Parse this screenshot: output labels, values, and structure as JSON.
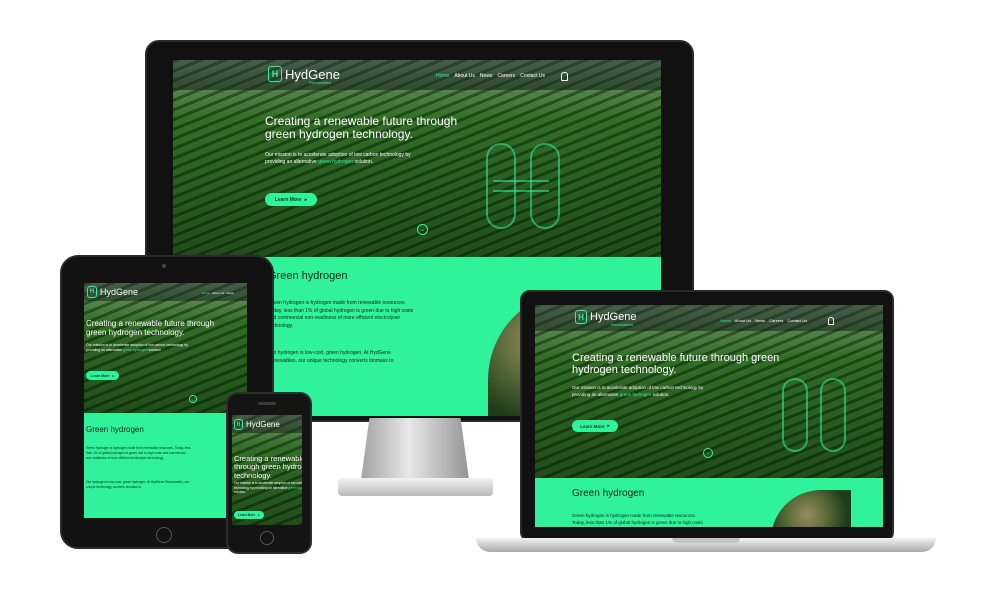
{
  "site": {
    "logo_text": "HydGene",
    "logo_sub": "Renewables",
    "nav": [
      "Home",
      "About Us",
      "News",
      "Careers",
      "Contact Us"
    ],
    "user_icon": "user-icon"
  },
  "hero": {
    "title": "Creating a renewable future through green hydrogen technology.",
    "text_before": "Our mission is to accelerate adoption of low carbon technology by providing an alternative ",
    "text_highlight": "green hydrogen",
    "text_after": " solution.",
    "button": "Learn More"
  },
  "section": {
    "title": "Green hydrogen",
    "p1": "Green hydrogen is hydrogen made from renewable resources. Today, less than 1% of global hydrogen is green due to high costs and commercial non-readiness of more efficient electrolyser technology.",
    "p2": "Our hydrogen is low-cost, green hydrogen. At HydGene Renewables, our unique technology converts biomass to"
  },
  "colors": {
    "accent": "#2ff29a",
    "nav_active": "#36f0a0",
    "dark_text": "#0b2a18"
  }
}
